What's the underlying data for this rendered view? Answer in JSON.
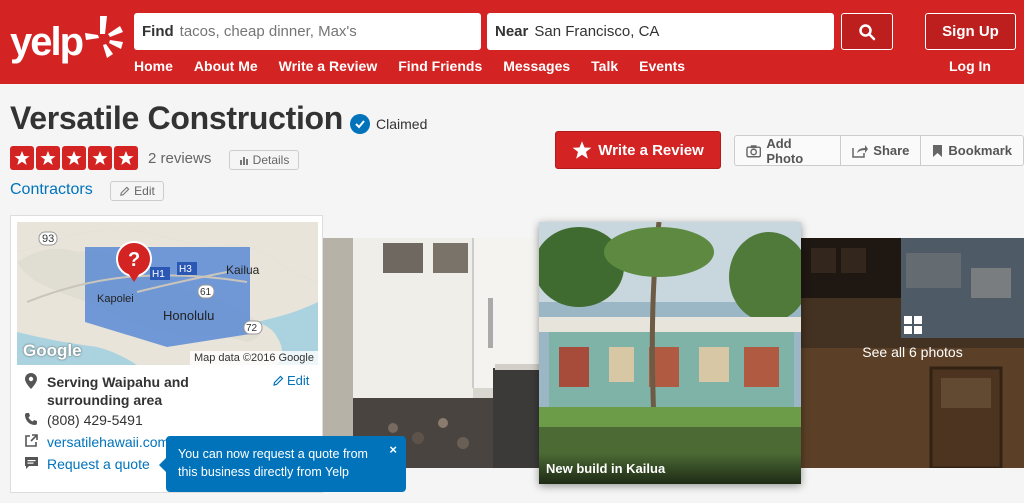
{
  "header": {
    "logo_text": "yelp",
    "find_label": "Find",
    "find_placeholder": "tacos, cheap dinner, Max's",
    "near_label": "Near",
    "near_value": "San Francisco, CA",
    "signup_label": "Sign Up",
    "login_label": "Log In",
    "nav": [
      "Home",
      "About Me",
      "Write a Review",
      "Find Friends",
      "Messages",
      "Talk",
      "Events"
    ],
    "brand_color": "#d32323"
  },
  "business": {
    "name": "Versatile Construction",
    "claimed_label": "Claimed",
    "rating": 5,
    "review_count": "2 reviews",
    "details_label": "Details",
    "category": "Contractors",
    "edit_label": "Edit"
  },
  "actions": {
    "write_review": "Write a Review",
    "add_photo": "Add Photo",
    "share": "Share",
    "bookmark": "Bookmark"
  },
  "map": {
    "credit": "Map data ©2016 Google",
    "google_label": "Google",
    "labels": [
      "93",
      "H1",
      "H3",
      "Kailua",
      "Kapolei",
      "61",
      "Honolulu",
      "72"
    ]
  },
  "info": {
    "service_area": "Serving Waipahu and surrounding area",
    "edit_label": "Edit",
    "phone": "(808) 429-5491",
    "website": "versatilehawaii.com",
    "request_quote": "Request a quote"
  },
  "photos": {
    "center_caption": "New build in Kailua",
    "see_all": "See all 6 photos"
  },
  "tooltip": {
    "text": "You can now request a quote from this business directly from Yelp",
    "close": "×"
  }
}
